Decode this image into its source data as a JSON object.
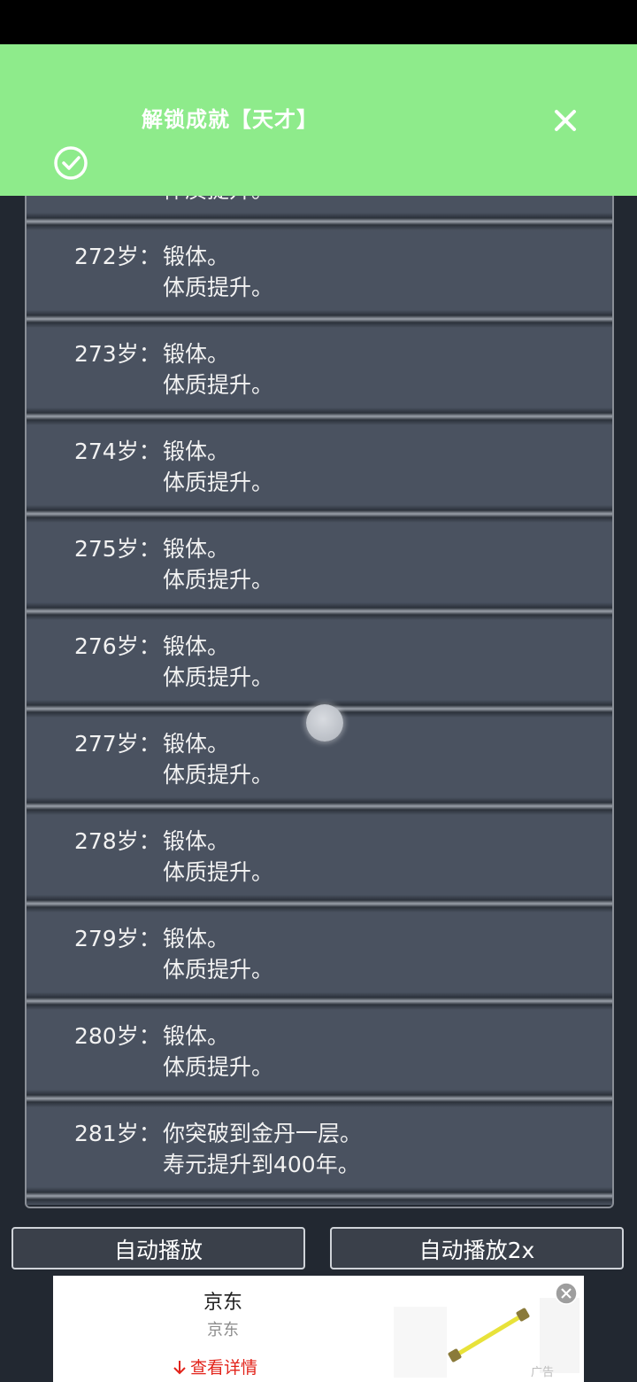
{
  "toast": {
    "message": "解锁成就【天才】"
  },
  "log": {
    "partial_line": "体质提升。",
    "entries": [
      {
        "age": "272岁：",
        "line1": "锻体。",
        "line2": "体质提升。"
      },
      {
        "age": "273岁：",
        "line1": "锻体。",
        "line2": "体质提升。"
      },
      {
        "age": "274岁：",
        "line1": "锻体。",
        "line2": "体质提升。"
      },
      {
        "age": "275岁：",
        "line1": "锻体。",
        "line2": "体质提升。"
      },
      {
        "age": "276岁：",
        "line1": "锻体。",
        "line2": "体质提升。"
      },
      {
        "age": "277岁：",
        "line1": "锻体。",
        "line2": "体质提升。"
      },
      {
        "age": "278岁：",
        "line1": "锻体。",
        "line2": "体质提升。"
      },
      {
        "age": "279岁：",
        "line1": "锻体。",
        "line2": "体质提升。"
      },
      {
        "age": "280岁：",
        "line1": "锻体。",
        "line2": "体质提升。"
      },
      {
        "age": "281岁：",
        "line1": "你突破到金丹一层。",
        "line2": "寿元提升到400年。"
      }
    ]
  },
  "buttons": {
    "auto_play": "自动播放",
    "auto_play_2x": "自动播放2x"
  },
  "ad": {
    "title": "京东",
    "subtitle": "京东",
    "detail": "查看详情",
    "label": "广告"
  },
  "colors": {
    "toast_bg": "#8EEB8B",
    "entry_bg": "#4a5260",
    "ad_detail": "#e2231a"
  }
}
